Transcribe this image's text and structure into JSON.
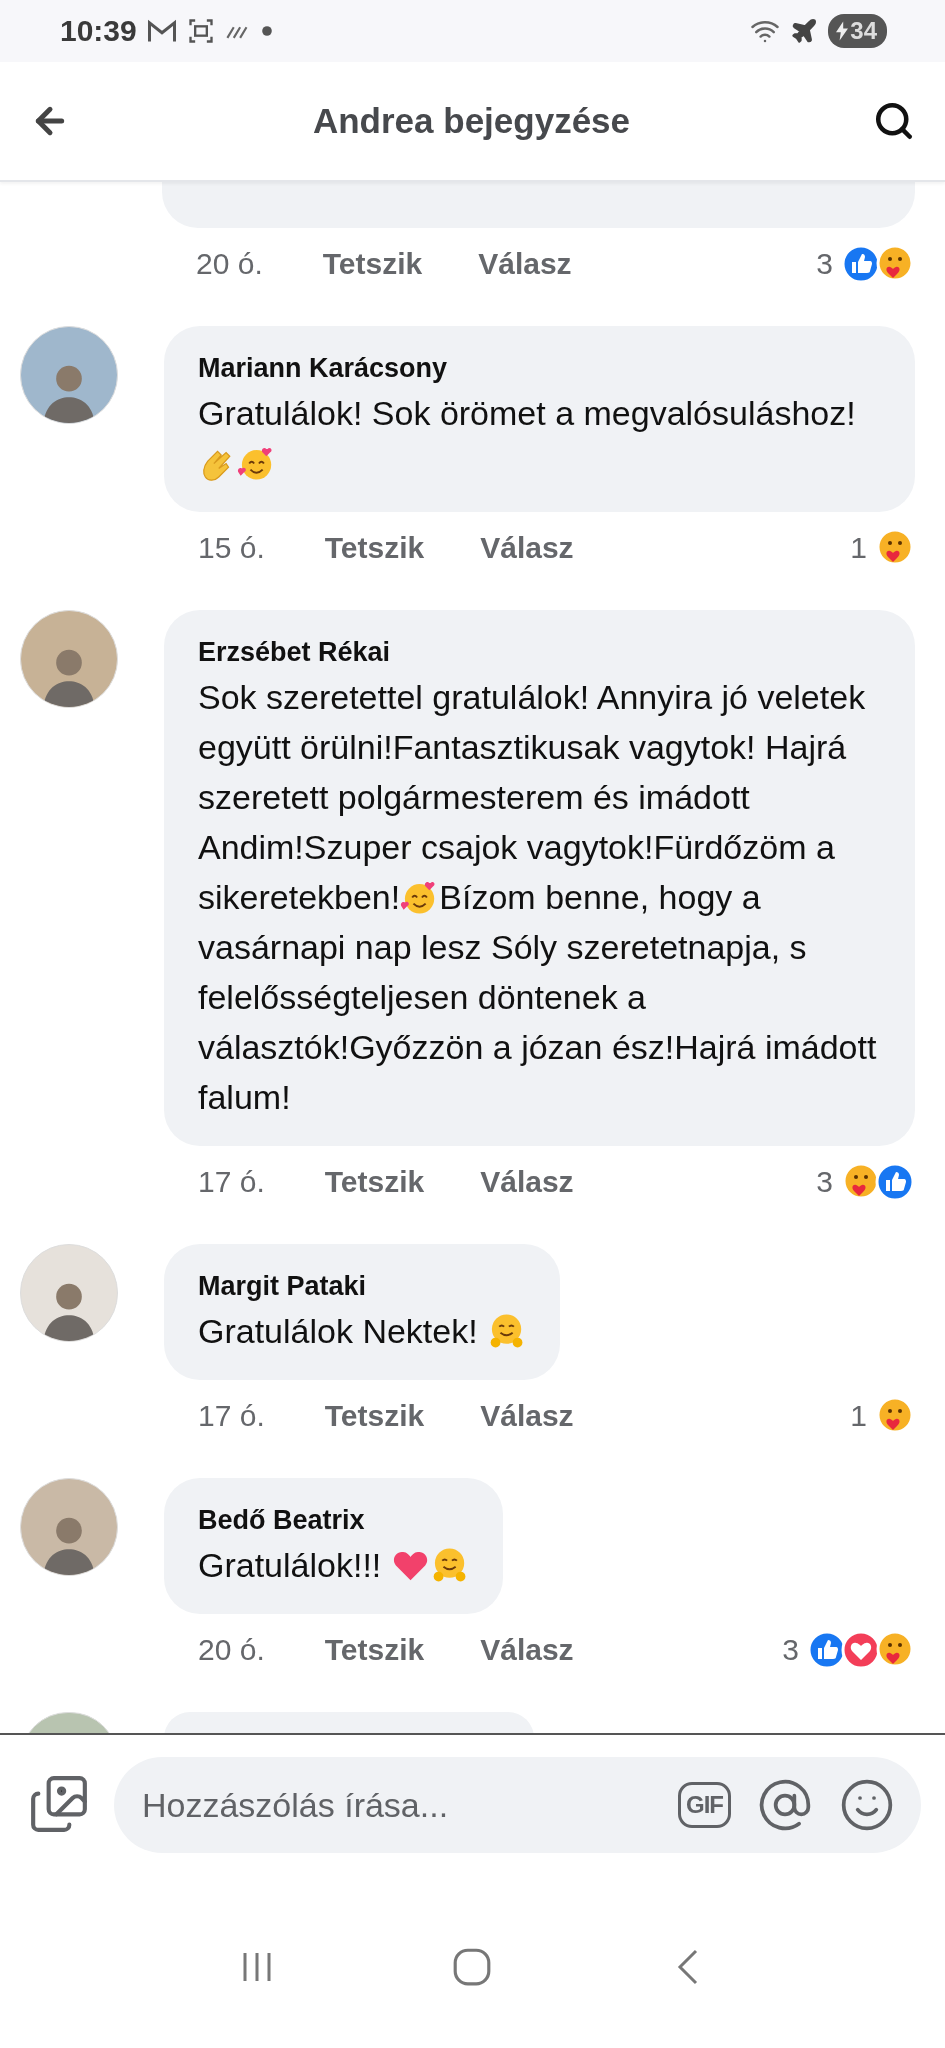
{
  "status_bar": {
    "time": "10:39",
    "battery": "34"
  },
  "header": {
    "title": "Andrea bejegyzése"
  },
  "comments": [
    {
      "kind": "cut",
      "time": "20 ó.",
      "like": "Tetszik",
      "reply": "Válasz",
      "count": "3",
      "reactions": [
        {
          "kind": "like"
        },
        {
          "kind": "care"
        }
      ]
    },
    {
      "kind": "full",
      "author": "Mariann Karácsony",
      "body": [
        {
          "kind": "text",
          "text": "Gratulálok! Sok örömet a megvalósuláshoz!"
        },
        {
          "kind": "clap"
        },
        {
          "kind": "smiling-hearts"
        }
      ],
      "time": "15 ó.",
      "like": "Tetszik",
      "reply": "Válasz",
      "count": "1",
      "reactions": [
        {
          "kind": "care"
        }
      ]
    },
    {
      "kind": "full",
      "author": "Erzsébet Rékai",
      "body": [
        {
          "kind": "text",
          "text": "Sok szeretettel gratulálok! Annyira jó veletek együtt örülni!Fantasztikusak vagytok! Hajrá szeretett polgármesterem és imádott Andim!Szuper csajok vagytok!Fürdőzöm a "
        },
        {
          "kind": "text",
          "text": "sikeretekben!"
        },
        {
          "kind": "smiling-hearts"
        },
        {
          "kind": "text",
          "text": "Bízom benne, hogy a "
        },
        {
          "kind": "text",
          "text": "vasárnapi nap lesz Sóly szeretetnapja, s felelősségteljesen döntenek a választók!Győzzön a józan ész!Hajrá imádott falum!"
        }
      ],
      "time": "17 ó.",
      "like": "Tetszik",
      "reply": "Válasz",
      "count": "3",
      "reactions": [
        {
          "kind": "care"
        },
        {
          "kind": "like"
        }
      ]
    },
    {
      "kind": "full",
      "author": "Margit Pataki",
      "body": [
        {
          "kind": "text",
          "text": "Gratulálok Nektek! "
        },
        {
          "kind": "hug"
        }
      ],
      "time": "17 ó.",
      "like": "Tetszik",
      "reply": "Válasz",
      "count": "1",
      "reactions": [
        {
          "kind": "care"
        }
      ]
    },
    {
      "kind": "full",
      "author": "Bedő Beatrix",
      "body": [
        {
          "kind": "text",
          "text": "Gratulálok!!! "
        },
        {
          "kind": "heart"
        },
        {
          "kind": "hug"
        }
      ],
      "time": "20 ó.",
      "like": "Tetszik",
      "reply": "Válasz",
      "count": "3",
      "reactions": [
        {
          "kind": "like"
        },
        {
          "kind": "love"
        },
        {
          "kind": "care"
        }
      ]
    },
    {
      "kind": "cut-below"
    }
  ],
  "composer": {
    "placeholder": "Hozzászólás írása...",
    "gif": "GIF"
  }
}
